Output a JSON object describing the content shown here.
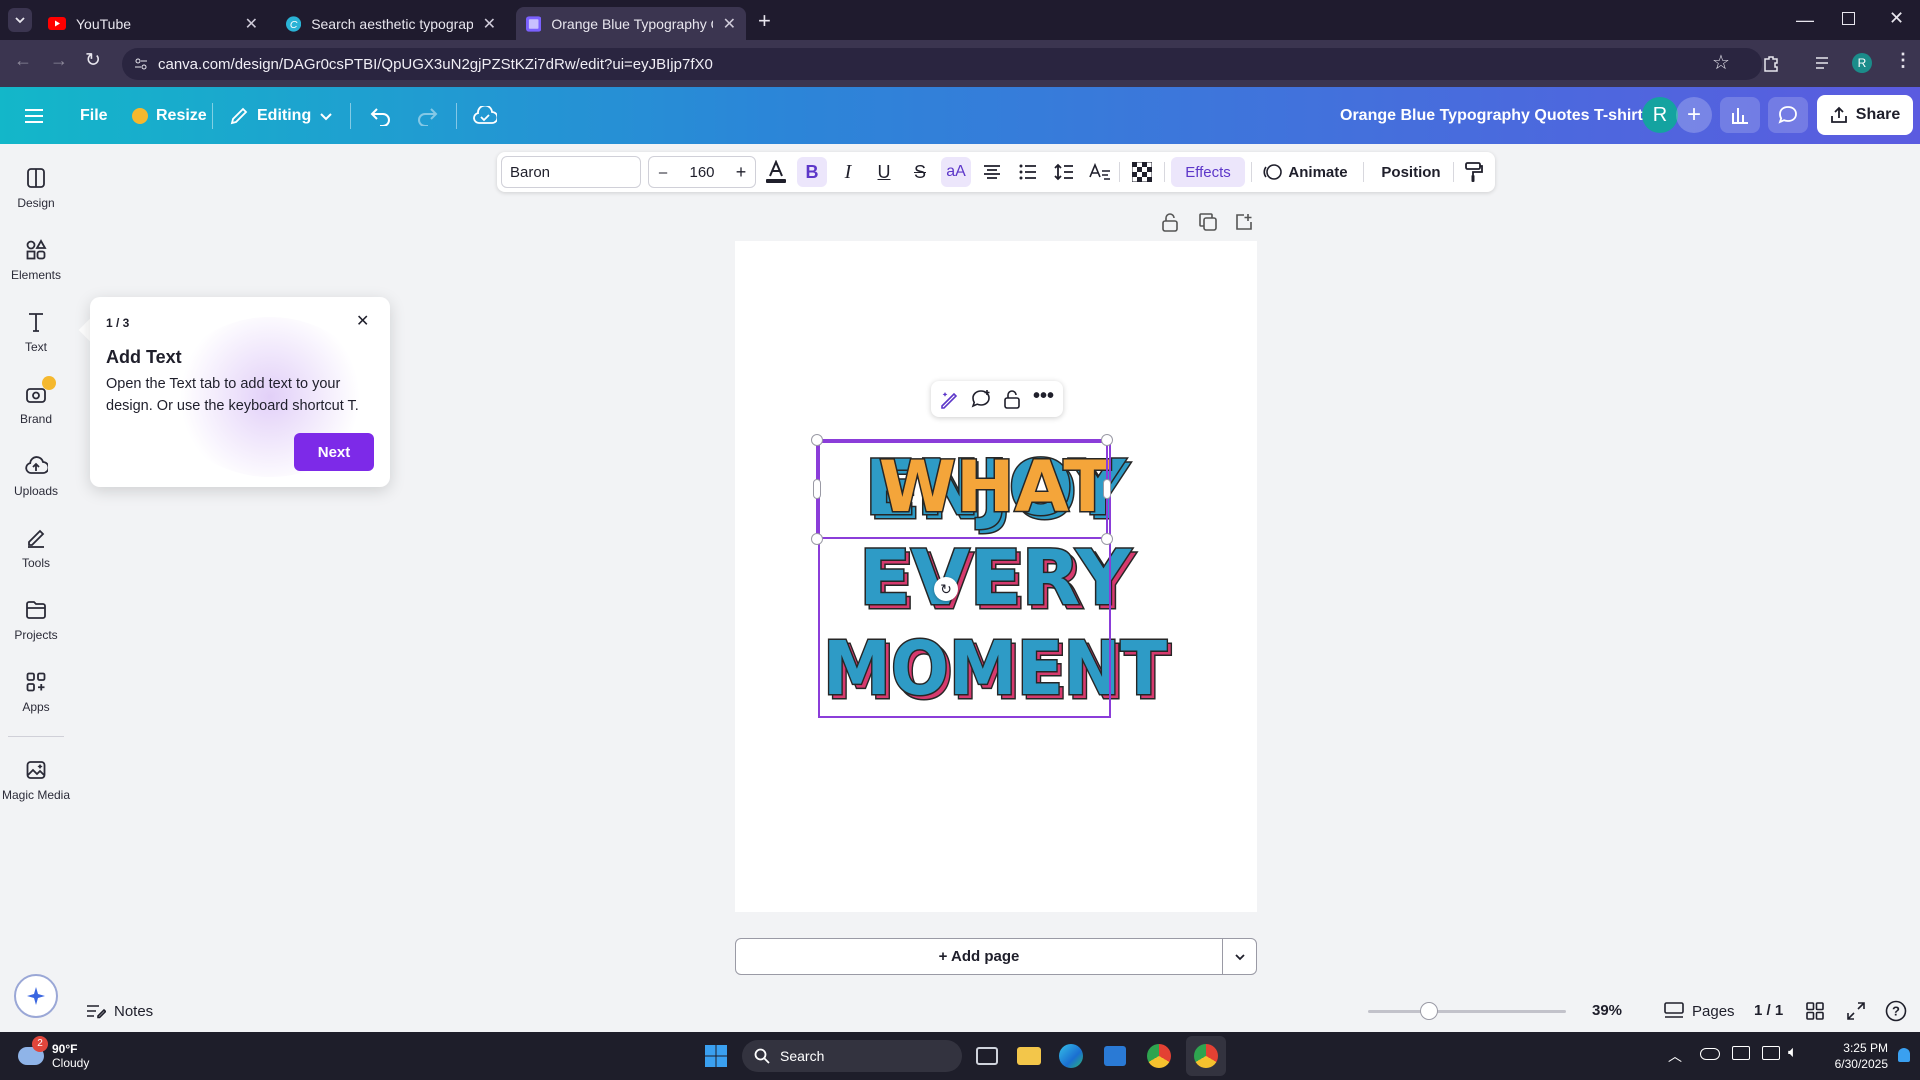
{
  "browser": {
    "tabs": [
      {
        "label": "YouTube",
        "icon": "youtube-icon",
        "active": false
      },
      {
        "label": "Search aesthetic typography po",
        "icon": "canva-icon",
        "active": false
      },
      {
        "label": "Orange Blue Typography Quote",
        "icon": "canva-doc-icon",
        "active": true
      }
    ],
    "url": "canva.com/design/DAGr0csPTBI/QpUGX3uN2gjPZStKZi7dRw/edit?ui=eyJBIjp7fX0",
    "profile_initial": "R"
  },
  "header": {
    "file_label": "File",
    "resize_label": "Resize",
    "editing_label": "Editing",
    "doc_title": "Orange Blue Typography Quotes T-shirts",
    "avatar_initial": "R",
    "share_label": "Share"
  },
  "sidebar": {
    "items": [
      {
        "label": "Design",
        "icon": "design-icon"
      },
      {
        "label": "Elements",
        "icon": "elements-icon"
      },
      {
        "label": "Text",
        "icon": "text-icon"
      },
      {
        "label": "Brand",
        "icon": "brand-icon"
      },
      {
        "label": "Uploads",
        "icon": "uploads-icon"
      },
      {
        "label": "Tools",
        "icon": "tools-icon"
      },
      {
        "label": "Projects",
        "icon": "projects-icon"
      },
      {
        "label": "Apps",
        "icon": "apps-icon"
      },
      {
        "label": "Magic Media",
        "icon": "magic-media-icon"
      }
    ]
  },
  "toolbar": {
    "font_name": "Baron",
    "minus_label": "–",
    "font_size": "160",
    "plus_label": "+",
    "case_label": "aA",
    "effects_label": "Effects",
    "animate_label": "Animate",
    "position_label": "Position"
  },
  "popup": {
    "step": "1 / 3",
    "title": "Add Text",
    "body": "Open the Text tab to add text to your design. Or use the keyboard shortcut T.",
    "next_label": "Next"
  },
  "canvas": {
    "text_lines": [
      "ENJOY",
      "WHAT",
      "EVERY",
      "MOMENT"
    ],
    "colors": {
      "blue": "#2e9bc6",
      "pink": "#d63a6e",
      "orange": "#f4a53a",
      "selection": "#8b3dd9"
    }
  },
  "bottom": {
    "add_page_label": "+ Add page",
    "notes_label": "Notes",
    "zoom_value": 39,
    "zoom_label": "39%",
    "pages_label": "Pages",
    "page_count": "1 / 1"
  },
  "taskbar": {
    "weather_temp": "90°F",
    "weather_desc": "Cloudy",
    "weather_badge": "2",
    "search_label": "Search",
    "time": "3:25 PM",
    "date": "6/30/2025"
  }
}
